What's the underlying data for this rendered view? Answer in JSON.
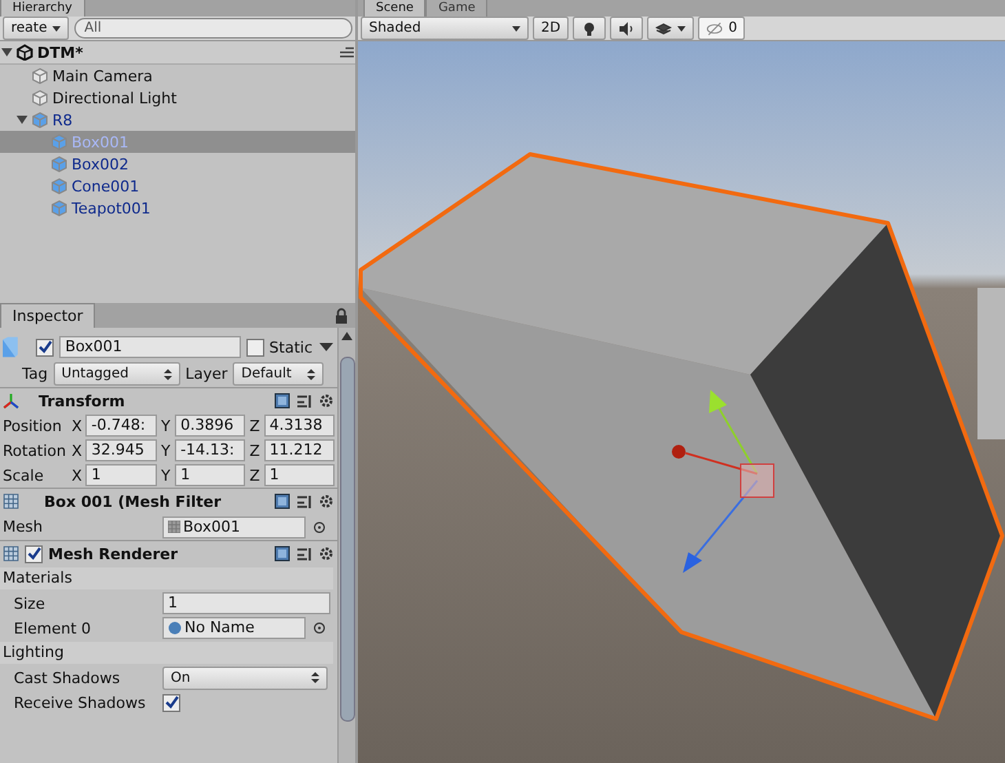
{
  "hierarchy": {
    "tab": "Hierarchy",
    "create": "reate",
    "search": {
      "placeholder": "All"
    },
    "scene": {
      "name": "DTM*",
      "expanded": true
    },
    "items": [
      {
        "name": "Main Camera",
        "prefab": false,
        "selected": false
      },
      {
        "name": "Directional Light",
        "prefab": false,
        "selected": false
      },
      {
        "name": "R8",
        "prefab": true,
        "selected": false,
        "expanded": true,
        "children": [
          {
            "name": "Box001",
            "prefab": true,
            "selected": true
          },
          {
            "name": "Box002",
            "prefab": true,
            "selected": false
          },
          {
            "name": "Cone001",
            "prefab": true,
            "selected": false
          },
          {
            "name": "Teapot001",
            "prefab": true,
            "selected": false
          }
        ]
      }
    ]
  },
  "scene_view": {
    "tabs": [
      {
        "label": "Scene",
        "selected": true
      },
      {
        "label": "Game",
        "selected": false
      }
    ],
    "shading": "Shaded",
    "mode_2d": "2D",
    "mode_2d_on": false,
    "hidden_count": "0"
  },
  "inspector": {
    "tab": "Inspector",
    "object": {
      "active": true,
      "name": "Box001",
      "static": false,
      "static_label": "Static",
      "tag_label": "Tag",
      "tag": "Untagged",
      "layer_label": "Layer",
      "layer": "Default"
    },
    "components": [
      {
        "kind": "transform",
        "title": "Transform",
        "rows": [
          {
            "label": "Position",
            "values": [
              {
                "axis": "X",
                "value": "-0.748:"
              },
              {
                "axis": "Y",
                "value": "0.3896"
              },
              {
                "axis": "Z",
                "value": "4.3138"
              }
            ]
          },
          {
            "label": "Rotation",
            "values": [
              {
                "axis": "X",
                "value": "32.945"
              },
              {
                "axis": "Y",
                "value": "-14.13:"
              },
              {
                "axis": "Z",
                "value": "11.212"
              }
            ]
          },
          {
            "label": "Scale",
            "values": [
              {
                "axis": "X",
                "value": "1"
              },
              {
                "axis": "Y",
                "value": "1"
              },
              {
                "axis": "Z",
                "value": "1"
              }
            ]
          }
        ]
      },
      {
        "kind": "mesh_filter",
        "title": "Box 001 (Mesh Filter",
        "label": "Mesh",
        "value": "Box001"
      },
      {
        "kind": "mesh_renderer",
        "title": "Mesh Renderer",
        "enabled": true,
        "sections": [
          {
            "title": "Materials",
            "rows": [
              {
                "kind": "text",
                "label": "Size",
                "value": "1"
              },
              {
                "kind": "object",
                "label": "Element 0",
                "value": "No Name"
              }
            ]
          },
          {
            "title": "Lighting",
            "rows": [
              {
                "kind": "dropdown",
                "label": "Cast Shadows",
                "value": "On"
              },
              {
                "kind": "check",
                "label": "Receive Shadows",
                "checked": true
              }
            ]
          }
        ]
      }
    ]
  }
}
